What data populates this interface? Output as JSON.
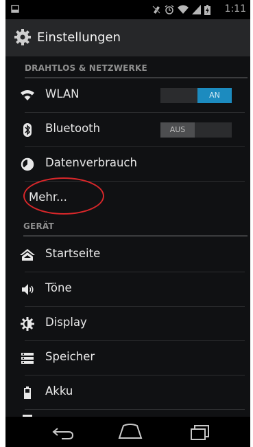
{
  "status_bar": {
    "time": "1:11"
  },
  "action_bar": {
    "title": "Einstellungen",
    "icon": "gear-icon"
  },
  "sections": {
    "wireless": "DRAHTLOS & NETZWERKE",
    "device": "GERÄT"
  },
  "items": {
    "wlan": {
      "label": "WLAN",
      "icon": "wifi-icon",
      "toggle": "AN"
    },
    "bluetooth": {
      "label": "Bluetooth",
      "icon": "bluetooth-icon",
      "toggle": "AUS"
    },
    "data_usage": {
      "label": "Datenverbrauch",
      "icon": "data-usage-icon"
    },
    "more": {
      "label": "Mehr..."
    },
    "home": {
      "label": "Startseite",
      "icon": "home-icon"
    },
    "sound": {
      "label": "Töne",
      "icon": "speaker-icon"
    },
    "display": {
      "label": "Display",
      "icon": "display-icon"
    },
    "storage": {
      "label": "Speicher",
      "icon": "storage-icon"
    },
    "battery": {
      "label": "Akku",
      "icon": "battery-icon"
    }
  },
  "colors": {
    "accent": "#1c8bbf",
    "annotation": "#d8272a",
    "background": "#101113"
  }
}
